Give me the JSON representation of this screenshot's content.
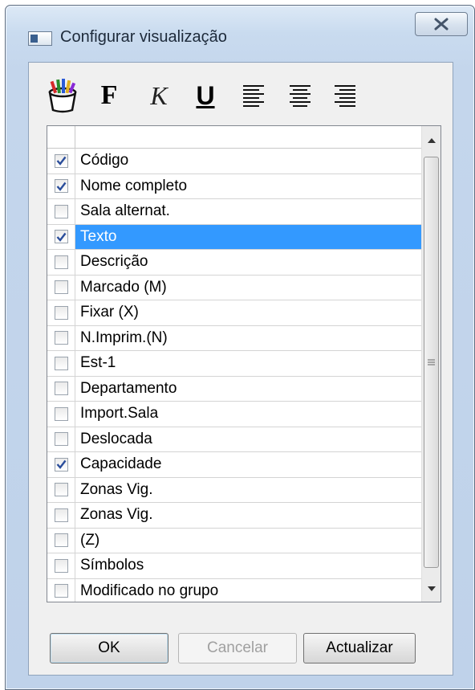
{
  "window": {
    "title": "Configurar visualização",
    "close_glyph": "X"
  },
  "toolbar": {
    "bold_label": "F",
    "italic_label": "K",
    "underline_label": "U"
  },
  "list": {
    "items": [
      {
        "label": "Código",
        "checked": true
      },
      {
        "label": "Nome completo",
        "checked": true
      },
      {
        "label": "Sala alternat.",
        "checked": false
      },
      {
        "label": "Texto",
        "checked": true,
        "selected": true
      },
      {
        "label": "Descrição",
        "checked": false
      },
      {
        "label": "Marcado (M)",
        "checked": false
      },
      {
        "label": "Fixar (X)",
        "checked": false
      },
      {
        "label": "N.Imprim.(N)",
        "checked": false
      },
      {
        "label": "Est-1",
        "checked": false
      },
      {
        "label": "Departamento",
        "checked": false
      },
      {
        "label": "Import.Sala",
        "checked": false
      },
      {
        "label": "Deslocada",
        "checked": false
      },
      {
        "label": "Capacidade",
        "checked": true
      },
      {
        "label": "Zonas Vig.",
        "checked": false
      },
      {
        "label": "Zonas Vig.",
        "checked": false
      },
      {
        "label": "(Z)",
        "checked": false
      },
      {
        "label": "Símbolos",
        "checked": false
      },
      {
        "label": "Modificado no grupo",
        "checked": false
      }
    ]
  },
  "buttons": {
    "ok": "OK",
    "cancel": "Cancelar",
    "update": "Actualizar"
  },
  "colors": {
    "selection": "#3399ff",
    "check_mark": "#2a4d9b"
  }
}
